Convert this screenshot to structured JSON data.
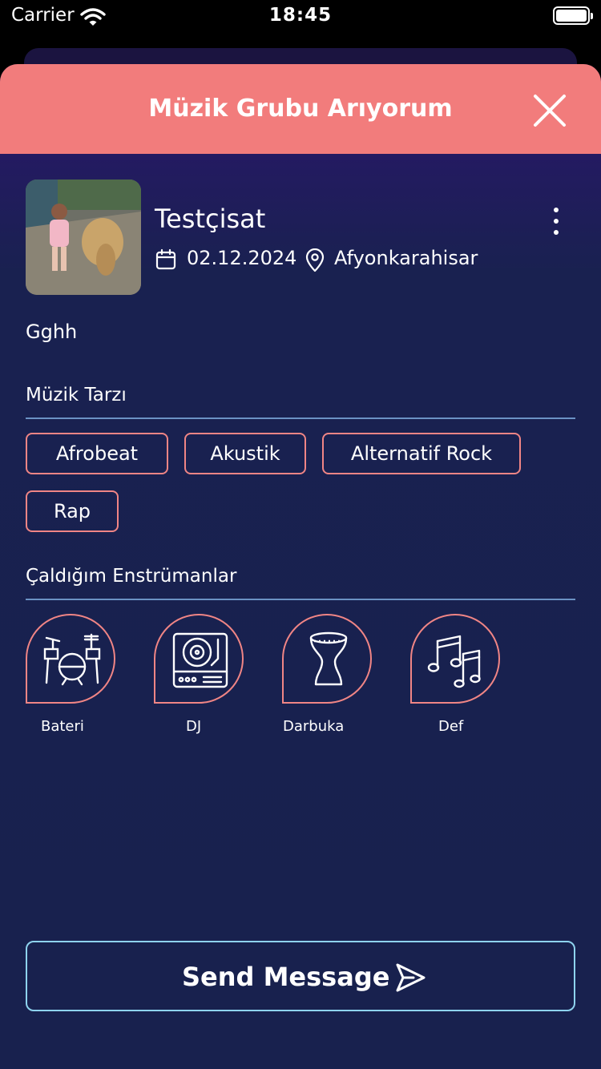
{
  "status_bar": {
    "carrier": "Carrier",
    "time": "18:45"
  },
  "header": {
    "title": "Müzik Grubu Arıyorum"
  },
  "post": {
    "user_name": "Testçisat",
    "date": "02.12.2024",
    "location": "Afyonkarahisar",
    "description": "Gghh"
  },
  "music_style": {
    "title": "Müzik Tarzı",
    "genres": [
      "Afrobeat",
      "Akustik",
      "Alternatif Rock",
      "Rap"
    ]
  },
  "instruments": {
    "title": "Çaldığım Enstrümanlar",
    "items": [
      {
        "label": "Bateri",
        "icon": "drum-kit-icon"
      },
      {
        "label": "DJ",
        "icon": "turntable-icon"
      },
      {
        "label": "Darbuka",
        "icon": "darbuka-icon"
      },
      {
        "label": "Def",
        "icon": "music-notes-icon"
      }
    ]
  },
  "actions": {
    "send_label": "Send Message"
  },
  "colors": {
    "header": "#f27c7c",
    "chip_border": "#f08585",
    "button_border": "#8ed3ee",
    "background_top": "#34197a",
    "background_bottom": "#18214e"
  }
}
